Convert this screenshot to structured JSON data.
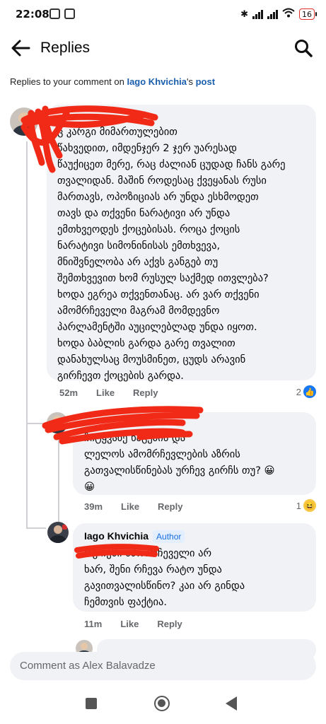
{
  "status_bar": {
    "time": "22:08",
    "battery": "16"
  },
  "header": {
    "title": "Replies",
    "back_icon": "arrow-left-icon",
    "search_icon": "search-icon"
  },
  "context": {
    "prefix": "Replies to your comment on ",
    "author_link": "Iago Khvichia",
    "possessive": "'s ",
    "post_link": "post"
  },
  "comments": [
    {
      "text": "ც კარგი მიმართულებით\nწახვედით, იმდენჯერ 2 ჯერ უარესად\nწაუქიცეთ მერე, რაც ძალიან ცუდად ჩანს გარე\nთვალიდან. მაშინ როდესაც ქვეყანას რუსი\nმართავს, ოპოზიციას არ უნდა ესხმოდეთ\nთავს და თქვენი ნარატივი არ უნდა\nემთხვეოდეს ქოცებისას.  როცა ქოცის\nნარატივი სიმონინისას ემთხვევა,\nმნიშვნელობა არ აქვს განგებ თუ\nშემთხვევით ხომ რუსულ საქმედ ითვლება?\nხოდა ეგრეა თქვენთანაც.  არ ვარ თქვენი\nამომრჩეველი მაგრამ მომდევნო\nპარლამენტში აუცილებლად უნდა იყოთ.\nხოდა ბაბლის გარდა გარე თვალით\nდანახულსაც მოუსმინეთ, ცუდს არავინ\nგირჩევთ ქოცების გარდა.",
      "time": "52m",
      "like": "Like",
      "reply": "Reply",
      "reaction_count": "2",
      "reaction": "like"
    },
    {
      "text": "ჩიტყვაზე ნაცების და\nლელოს ამომრჩევლების აზრის\nგათვალისწინებას ურჩევ გირჩს თუ? 😀\n😀",
      "time": "39m",
      "like": "Like",
      "reply": "Reply",
      "reaction_count": "1",
      "reaction": "haha"
    },
    {
      "author": "Iago Khvichia",
      "badge": "Author",
      "text": "თუ ჩემი ამომრჩეველი არ\nხარ, შენი რჩევა რატო უნდა\nგავითვალისწინო? კაი არ გინდა\nჩემთვის ფაქტია.",
      "time": "11m",
      "like": "Like",
      "reply": "Reply"
    }
  ],
  "comment_input": {
    "placeholder": "Comment as Alex Balavadze"
  },
  "colors": {
    "accent": "#1877f2",
    "link": "#1b5fae",
    "bubble": "#f0f2f5",
    "redaction": "#f02a17"
  }
}
